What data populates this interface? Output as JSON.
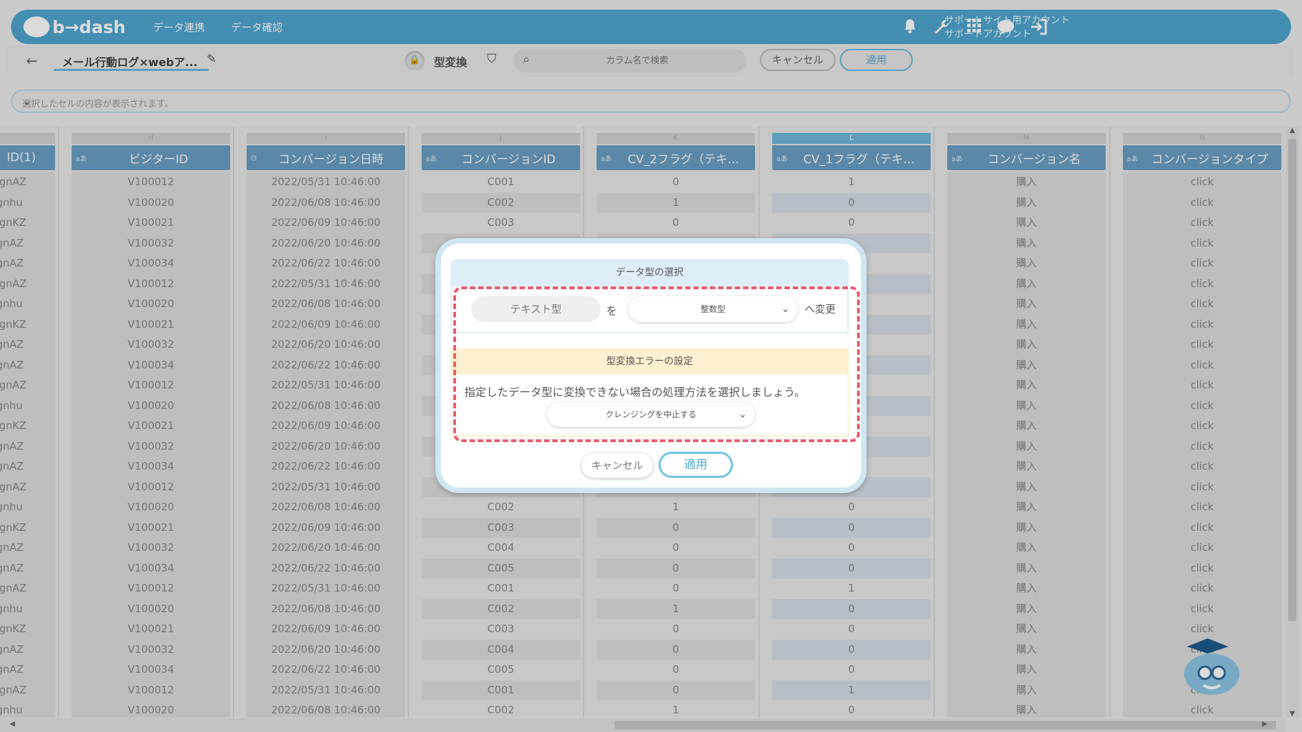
{
  "brand": {
    "logo_text": "b→dash"
  },
  "nav": [
    "データ連携",
    "データ確認"
  ],
  "account": {
    "line1": "サポートサイト用アカウント",
    "line2": "サポートアカウント"
  },
  "header_icons": [
    "bell-icon",
    "wrench-icon",
    "grid-icon",
    "chat-icon",
    "logout-icon"
  ],
  "toolbar": {
    "back_icon": "←",
    "title": "メール行動ログ×webア...",
    "mode_label": "型変換",
    "search_placeholder": "カラム名で検索",
    "cancel_label": "キャンセル",
    "apply_label": "適用"
  },
  "cellbar": {
    "placeholder": "選択したセルの内容が表示されます。"
  },
  "columns": [
    {
      "letter": "",
      "name": "ID(1)",
      "type_badge": "",
      "key": "id1",
      "selected": false
    },
    {
      "letter": "H",
      "name": "ビジターID",
      "type_badge": "aあ",
      "key": "visitor",
      "selected": false
    },
    {
      "letter": "I",
      "name": "コンバージョン日時",
      "type_badge": "◷",
      "key": "cvdate",
      "selected": false
    },
    {
      "letter": "J",
      "name": "コンバージョンID",
      "type_badge": "aあ",
      "key": "cvid",
      "selected": false
    },
    {
      "letter": "K",
      "name": "CV_2フラグ（テキ…",
      "type_badge": "aあ",
      "key": "cv2",
      "selected": false
    },
    {
      "letter": "L",
      "name": "CV_1フラグ（テキ…",
      "type_badge": "aあ",
      "key": "cv1",
      "selected": true
    },
    {
      "letter": "M",
      "name": "コンバージョン名",
      "type_badge": "aあ",
      "key": "cvname",
      "selected": false
    },
    {
      "letter": "N",
      "name": "コンバージョンタイプ",
      "type_badge": "aあ",
      "key": "cvtype",
      "selected": false
    }
  ],
  "rows": [
    {
      "id1": "l,gnAZ",
      "visitor": "V100012",
      "cvdate": "2022/05/31 10:46:00",
      "cvid": "C001",
      "cv2": "0",
      "cv1": "1",
      "cvname": "購入",
      "cvtype": "click"
    },
    {
      "id1": ",gnhu",
      "visitor": "V100020",
      "cvdate": "2022/06/08 10:46:00",
      "cvid": "C002",
      "cv2": "1",
      "cv1": "0",
      "cvname": "購入",
      "cvtype": "click"
    },
    {
      "id1": "l,gnKZ",
      "visitor": "V100021",
      "cvdate": "2022/06/09 10:46:00",
      "cvid": "C003",
      "cv2": "0",
      "cv1": "0",
      "cvname": "購入",
      "cvtype": "click"
    },
    {
      "id1": ",gnAZ",
      "visitor": "V100032",
      "cvdate": "2022/06/20 10:46:00",
      "cvid": "",
      "cv2": "",
      "cv1": "",
      "cvname": "購入",
      "cvtype": "click"
    },
    {
      "id1": ",gnAZ",
      "visitor": "V100034",
      "cvdate": "2022/06/22 10:46:00",
      "cvid": "",
      "cv2": "",
      "cv1": "",
      "cvname": "購入",
      "cvtype": "click"
    },
    {
      "id1": "l,gnAZ",
      "visitor": "V100012",
      "cvdate": "2022/05/31 10:46:00",
      "cvid": "",
      "cv2": "",
      "cv1": "",
      "cvname": "購入",
      "cvtype": "click"
    },
    {
      "id1": ",gnhu",
      "visitor": "V100020",
      "cvdate": "2022/06/08 10:46:00",
      "cvid": "",
      "cv2": "",
      "cv1": "",
      "cvname": "購入",
      "cvtype": "click"
    },
    {
      "id1": "l,gnKZ",
      "visitor": "V100021",
      "cvdate": "2022/06/09 10:46:00",
      "cvid": "",
      "cv2": "",
      "cv1": "",
      "cvname": "購入",
      "cvtype": "click"
    },
    {
      "id1": ",gnAZ",
      "visitor": "V100032",
      "cvdate": "2022/06/20 10:46:00",
      "cvid": "",
      "cv2": "",
      "cv1": "",
      "cvname": "購入",
      "cvtype": "click"
    },
    {
      "id1": ",gnAZ",
      "visitor": "V100034",
      "cvdate": "2022/06/22 10:46:00",
      "cvid": "",
      "cv2": "",
      "cv1": "",
      "cvname": "購入",
      "cvtype": "click"
    },
    {
      "id1": "l,gnAZ",
      "visitor": "V100012",
      "cvdate": "2022/05/31 10:46:00",
      "cvid": "",
      "cv2": "",
      "cv1": "",
      "cvname": "購入",
      "cvtype": "click"
    },
    {
      "id1": ",gnhu",
      "visitor": "V100020",
      "cvdate": "2022/06/08 10:46:00",
      "cvid": "",
      "cv2": "",
      "cv1": "",
      "cvname": "購入",
      "cvtype": "click"
    },
    {
      "id1": "l,gnKZ",
      "visitor": "V100021",
      "cvdate": "2022/06/09 10:46:00",
      "cvid": "",
      "cv2": "",
      "cv1": "",
      "cvname": "購入",
      "cvtype": "click"
    },
    {
      "id1": ",gnAZ",
      "visitor": "V100032",
      "cvdate": "2022/06/20 10:46:00",
      "cvid": "",
      "cv2": "",
      "cv1": "",
      "cvname": "購入",
      "cvtype": "click"
    },
    {
      "id1": ",gnAZ",
      "visitor": "V100034",
      "cvdate": "2022/06/22 10:46:00",
      "cvid": "",
      "cv2": "",
      "cv1": "",
      "cvname": "購入",
      "cvtype": "click"
    },
    {
      "id1": "l,gnAZ",
      "visitor": "V100012",
      "cvdate": "2022/05/31 10:46:00",
      "cvid": "",
      "cv2": "",
      "cv1": "",
      "cvname": "購入",
      "cvtype": "click"
    },
    {
      "id1": ",gnhu",
      "visitor": "V100020",
      "cvdate": "2022/06/08 10:46:00",
      "cvid": "C002",
      "cv2": "1",
      "cv1": "0",
      "cvname": "購入",
      "cvtype": "click"
    },
    {
      "id1": "l,gnKZ",
      "visitor": "V100021",
      "cvdate": "2022/06/09 10:46:00",
      "cvid": "C003",
      "cv2": "0",
      "cv1": "0",
      "cvname": "購入",
      "cvtype": "click"
    },
    {
      "id1": ",gnAZ",
      "visitor": "V100032",
      "cvdate": "2022/06/20 10:46:00",
      "cvid": "C004",
      "cv2": "0",
      "cv1": "0",
      "cvname": "購入",
      "cvtype": "click"
    },
    {
      "id1": ",gnAZ",
      "visitor": "V100034",
      "cvdate": "2022/06/22 10:46:00",
      "cvid": "C005",
      "cv2": "0",
      "cv1": "0",
      "cvname": "購入",
      "cvtype": "click"
    },
    {
      "id1": "l,gnAZ",
      "visitor": "V100012",
      "cvdate": "2022/05/31 10:46:00",
      "cvid": "C001",
      "cv2": "0",
      "cv1": "1",
      "cvname": "購入",
      "cvtype": "click"
    },
    {
      "id1": ",gnhu",
      "visitor": "V100020",
      "cvdate": "2022/06/08 10:46:00",
      "cvid": "C002",
      "cv2": "1",
      "cv1": "0",
      "cvname": "購入",
      "cvtype": "click"
    },
    {
      "id1": "l,gnKZ",
      "visitor": "V100021",
      "cvdate": "2022/06/09 10:46:00",
      "cvid": "C003",
      "cv2": "0",
      "cv1": "0",
      "cvname": "購入",
      "cvtype": "click"
    },
    {
      "id1": ",gnAZ",
      "visitor": "V100032",
      "cvdate": "2022/06/20 10:46:00",
      "cvid": "C004",
      "cv2": "0",
      "cv1": "0",
      "cvname": "購入",
      "cvtype": "click"
    },
    {
      "id1": ",gnAZ",
      "visitor": "V100034",
      "cvdate": "2022/06/22 10:46:00",
      "cvid": "C005",
      "cv2": "0",
      "cv1": "0",
      "cvname": "購入",
      "cvtype": "click"
    },
    {
      "id1": "l,gnAZ",
      "visitor": "V100012",
      "cvdate": "2022/05/31 10:46:00",
      "cvid": "C001",
      "cv2": "0",
      "cv1": "1",
      "cvname": "購入",
      "cvtype": "click"
    },
    {
      "id1": ",gnhu",
      "visitor": "V100020",
      "cvdate": "2022/06/08 10:46:00",
      "cvid": "C002",
      "cv2": "1",
      "cv1": "0",
      "cvname": "購入",
      "cvtype": "click"
    }
  ],
  "modal": {
    "section1_title": "データ型の選択",
    "from_type": "テキスト型",
    "particle": "を",
    "to_type": "整数型",
    "change_suffix": "へ変更",
    "section2_title": "型変換エラーの設定",
    "message": "指定したデータ型に変換できない場合の処理方法を選択しましょう。",
    "error_option": "クレンジングを中止する",
    "cancel_label": "キャンセル",
    "apply_label": "適用"
  },
  "colors": {
    "header": "#4fa6cf",
    "column_header": "#6a9fc4",
    "highlight_dash": "#ea5a6b",
    "accent": "#6cc3e8"
  }
}
